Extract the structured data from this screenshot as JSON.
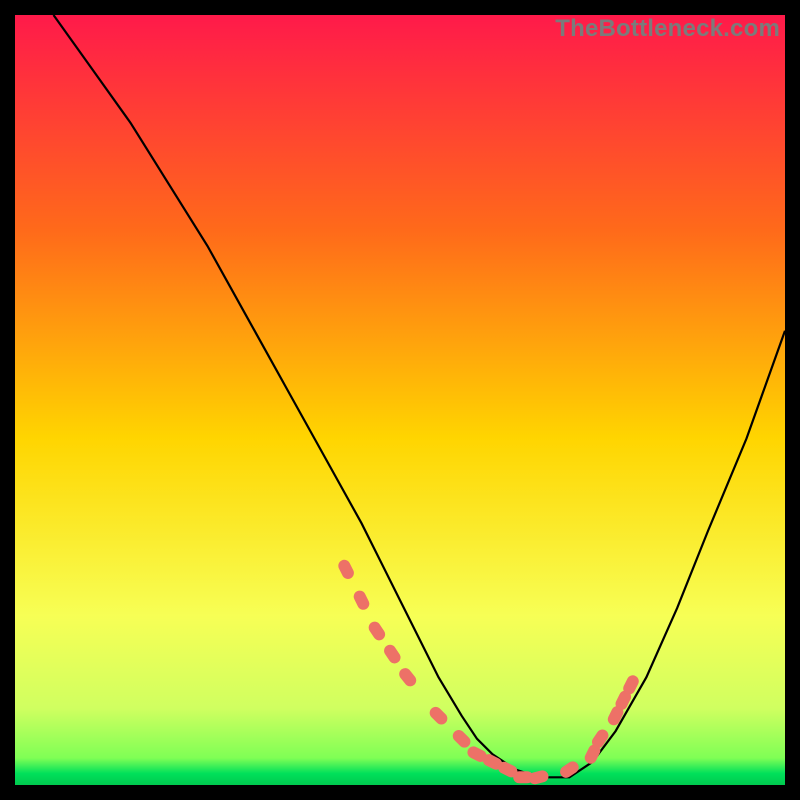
{
  "watermark": "TheBottleneck.com",
  "colors": {
    "bg": "#000000",
    "grad_top": "#ff1a4a",
    "grad_mid1": "#ff7a1a",
    "grad_mid2": "#ffd500",
    "grad_mid3": "#f7ff4a",
    "grad_low": "#d6ff60",
    "grad_green": "#00e05a",
    "curve": "#000000",
    "dot_fill": "#ed7167",
    "dot_stroke": "#d94c3f"
  },
  "chart_data": {
    "type": "line",
    "title": "",
    "xlabel": "",
    "ylabel": "",
    "xlim": [
      0,
      100
    ],
    "ylim": [
      0,
      100
    ],
    "series": [
      {
        "name": "bottleneck-curve",
        "x": [
          5,
          10,
          15,
          20,
          25,
          30,
          35,
          40,
          45,
          50,
          55,
          58,
          60,
          62,
          65,
          68,
          72,
          75,
          78,
          82,
          86,
          90,
          95,
          100
        ],
        "y": [
          100,
          93,
          86,
          78,
          70,
          61,
          52,
          43,
          34,
          24,
          14,
          9,
          6,
          4,
          2,
          1,
          1,
          3,
          7,
          14,
          23,
          33,
          45,
          59
        ]
      }
    ],
    "markers": {
      "name": "highlighted-range",
      "x": [
        43,
        45,
        47,
        49,
        51,
        55,
        58,
        60,
        62,
        64,
        66,
        68,
        72,
        75,
        76,
        78,
        79,
        80
      ],
      "y": [
        28,
        24,
        20,
        17,
        14,
        9,
        6,
        4,
        3,
        2,
        1,
        1,
        2,
        4,
        6,
        9,
        11,
        13
      ]
    },
    "gradient_stops": [
      {
        "offset": 0.0,
        "color": "#ff1a4a"
      },
      {
        "offset": 0.28,
        "color": "#ff6a1a"
      },
      {
        "offset": 0.55,
        "color": "#ffd500"
      },
      {
        "offset": 0.78,
        "color": "#f7ff55"
      },
      {
        "offset": 0.9,
        "color": "#d0ff60"
      },
      {
        "offset": 0.965,
        "color": "#7fff55"
      },
      {
        "offset": 0.985,
        "color": "#00e05a"
      },
      {
        "offset": 1.0,
        "color": "#00c94f"
      }
    ]
  }
}
